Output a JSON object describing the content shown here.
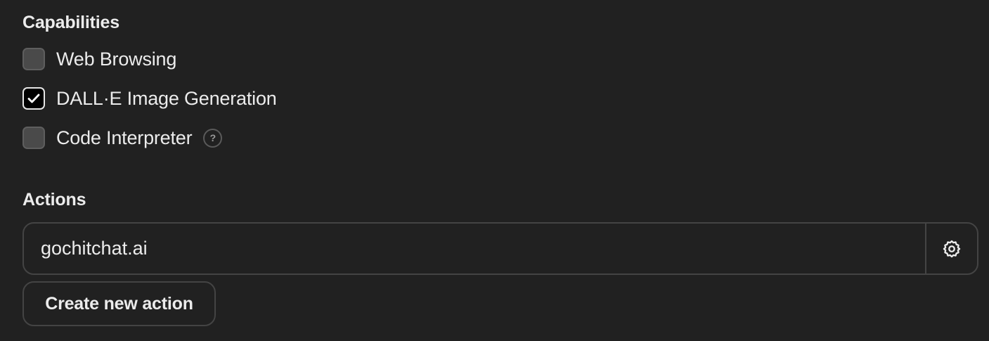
{
  "capabilities": {
    "heading": "Capabilities",
    "items": [
      {
        "label": "Web Browsing",
        "checked": false
      },
      {
        "label": "DALL·E Image Generation",
        "checked": true
      },
      {
        "label": "Code Interpreter",
        "checked": false,
        "help_icon": "question-mark-icon",
        "help_glyph": "?"
      }
    ]
  },
  "actions": {
    "heading": "Actions",
    "list": [
      {
        "domain": "gochitchat.ai",
        "settings_icon": "gear-icon"
      }
    ],
    "create_label": "Create new action"
  },
  "colors": {
    "background": "#212121",
    "text": "#ececec",
    "border": "#444444",
    "checkbox_unchecked": "#4a4a4a",
    "checkbox_checked": "#000000"
  }
}
